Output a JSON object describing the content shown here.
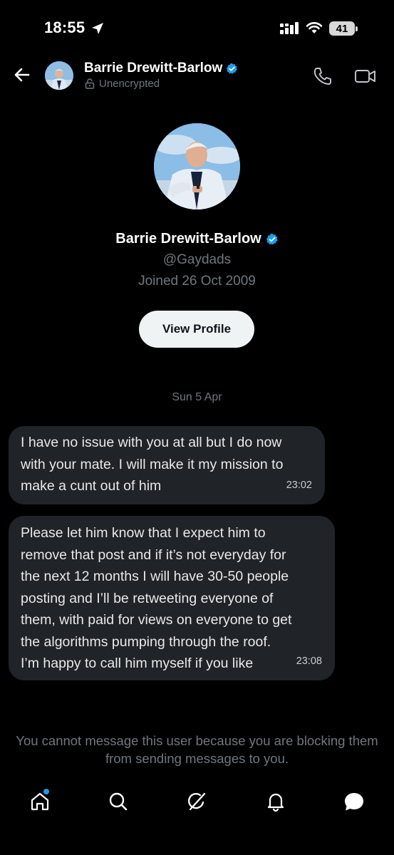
{
  "status_bar": {
    "time": "18:55",
    "battery": "41"
  },
  "header": {
    "name": "Barrie Drewitt-Barlow",
    "encryption_label": "Unencrypted"
  },
  "profile": {
    "name": "Barrie Drewitt-Barlow",
    "handle": "@Gaydads",
    "joined": "Joined 26 Oct 2009",
    "view_profile_label": "View Profile"
  },
  "conversation": {
    "date_separator": "Sun 5 Apr",
    "messages": [
      {
        "text": "I have no issue with you at all but I do now\nwith your mate. I will make it my mission to\nmake a cunt out of him",
        "time": "23:02"
      },
      {
        "text": "Please let him know that I expect him to\nremove that post and if it’s not everyday for\nthe next 12 months I will have 30-50 people\nposting and I’ll be retweeting everyone of\nthem, with paid for views on everyone to get\nthe algorithms pumping through the roof.\nI’m happy to call him myself if you like",
        "time": "23:08"
      }
    ],
    "blocked_notice": "You cannot message this user because you are blocking them from sending messages to you."
  },
  "colors": {
    "background": "#000000",
    "bubble": "#202327",
    "muted_text": "#71767b",
    "verified": "#1d9bf0",
    "button_bg": "#eff3f4"
  },
  "icons": {
    "back": "arrow-left-icon",
    "call": "phone-icon",
    "video": "video-camera-icon",
    "nav": [
      "home-icon",
      "search-icon",
      "grok-icon",
      "bell-icon",
      "messages-icon"
    ]
  }
}
